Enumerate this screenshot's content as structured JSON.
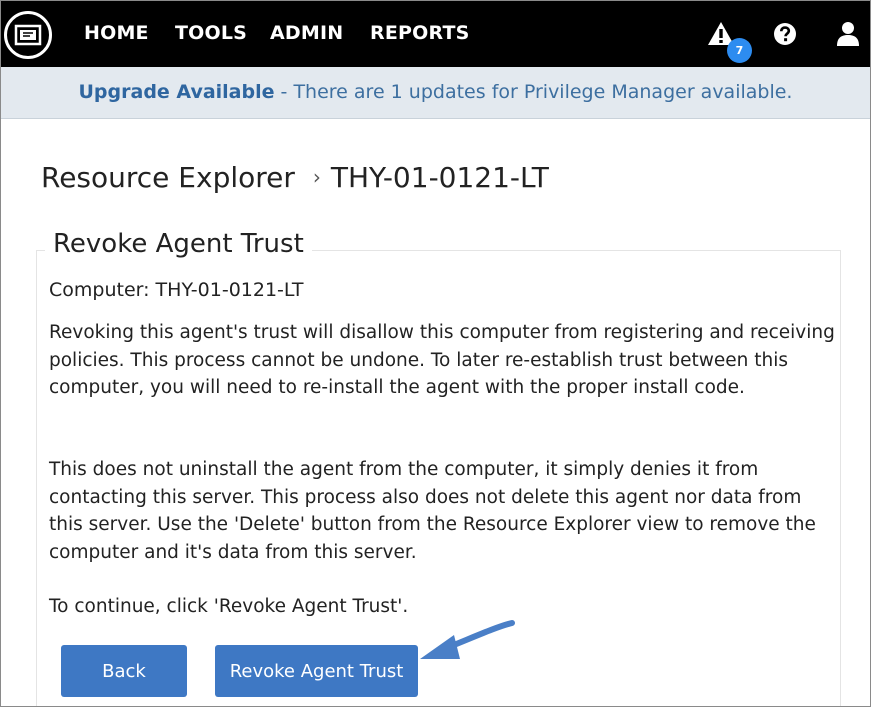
{
  "nav": {
    "items": [
      "HOME",
      "TOOLS",
      "ADMIN",
      "REPORTS"
    ],
    "alert_count": "7",
    "icons": [
      "logo-icon",
      "alert-icon",
      "help-icon",
      "user-icon"
    ]
  },
  "banner": {
    "strong": "Upgrade Available",
    "message": " - There are 1 updates for Privilege Manager available."
  },
  "breadcrumb": {
    "root": "Resource Explorer",
    "separator": "›",
    "current": "THY-01-0121-LT"
  },
  "panel": {
    "title": "Revoke Agent Trust",
    "computer": "Computer: THY-01-0121-LT",
    "paragraph1": "Revoking this agent's trust will disallow this computer from registering and receiving policies. This process cannot be undone. To later re-establish trust between this computer, you will need to re-install the agent with the proper install code.",
    "paragraph2": "This does not uninstall the agent from the computer, it simply denies it from contacting this server. This process also does not delete this agent nor data from this server. Use the 'Delete' button from the Resource Explorer view to remove the computer and it's data from this server.",
    "paragraph3": "To continue, click 'Revoke Agent Trust'."
  },
  "buttons": {
    "back": "Back",
    "revoke": "Revoke Agent Trust"
  },
  "colors": {
    "navbar": "#000000",
    "banner_bg": "#e3e9ef",
    "banner_text": "#3d6fa0",
    "button": "#3e78c4",
    "badge": "#2d8cf0",
    "arrow": "#4a7fc7"
  }
}
